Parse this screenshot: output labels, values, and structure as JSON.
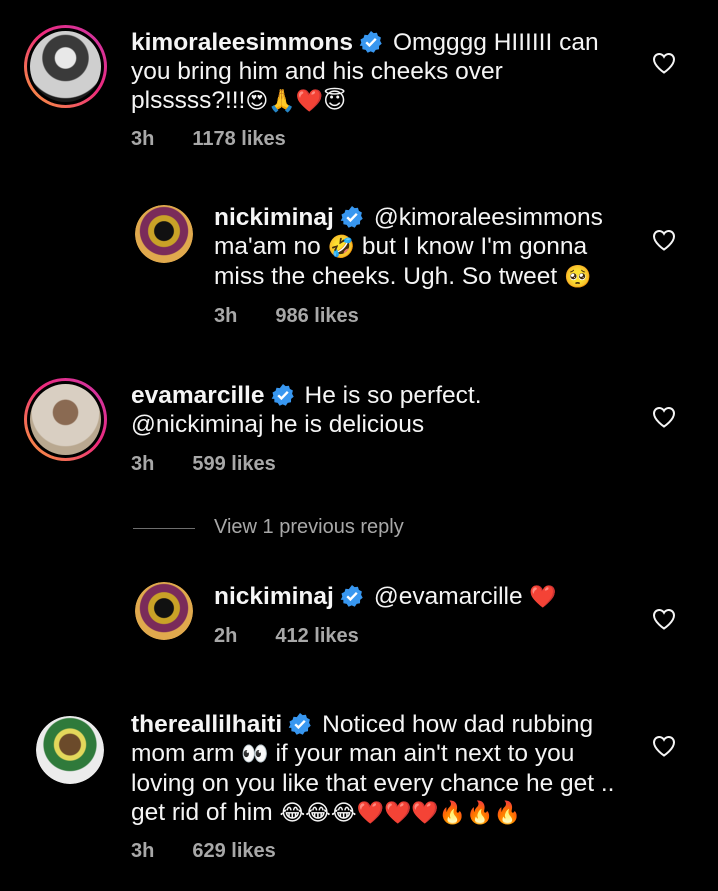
{
  "comments": [
    {
      "username": "kimoraleesimmons",
      "text": "Omgggg HIIIIII can you bring him and his cheeks over plsssss?!!!",
      "line1": "Omgggg HIIIIII can",
      "line2": "you bring him and his cheeks over",
      "line3": "plsssss?!!!",
      "emojis": "😍🙏❤️😇",
      "time": "3h",
      "likes": "1178 likes"
    },
    {
      "username": "nickiminaj",
      "mention": "@kimoraleesimmons",
      "line2a": "ma'am no",
      "emoji_mid": "🤣",
      "line2b": "but I know I'm gonna",
      "line3": "miss the cheeks. Ugh. So tweet",
      "emoji_end": "🥺",
      "time": "3h",
      "likes": "986 likes"
    },
    {
      "username": "evamarcille",
      "line1": "He is so perfect.",
      "line2": "@nickiminaj he is delicious",
      "time": "3h",
      "likes": "599 likes"
    },
    {
      "username": "nickiminaj",
      "mention": "@evamarcille",
      "emoji_end": "❤️",
      "time": "2h",
      "likes": "412 likes"
    },
    {
      "username": "thereallilhaiti",
      "line1": "Noticed how dad rubbing",
      "line2a": "mom arm",
      "emoji_eyes": "👀",
      "line2b": "if your man ain't next to you",
      "line3": "loving on you like that every chance he get ..",
      "line4": "get rid of him",
      "emojis_end": "😂😂😂❤️❤️❤️🔥🔥🔥",
      "time": "3h",
      "likes": "629 likes"
    }
  ],
  "view_replies_label": "View 1 previous reply",
  "colors": {
    "background": "#000000",
    "text": "#f5f5f5",
    "meta": "#a8a8a8",
    "verified": "#3897f0"
  }
}
